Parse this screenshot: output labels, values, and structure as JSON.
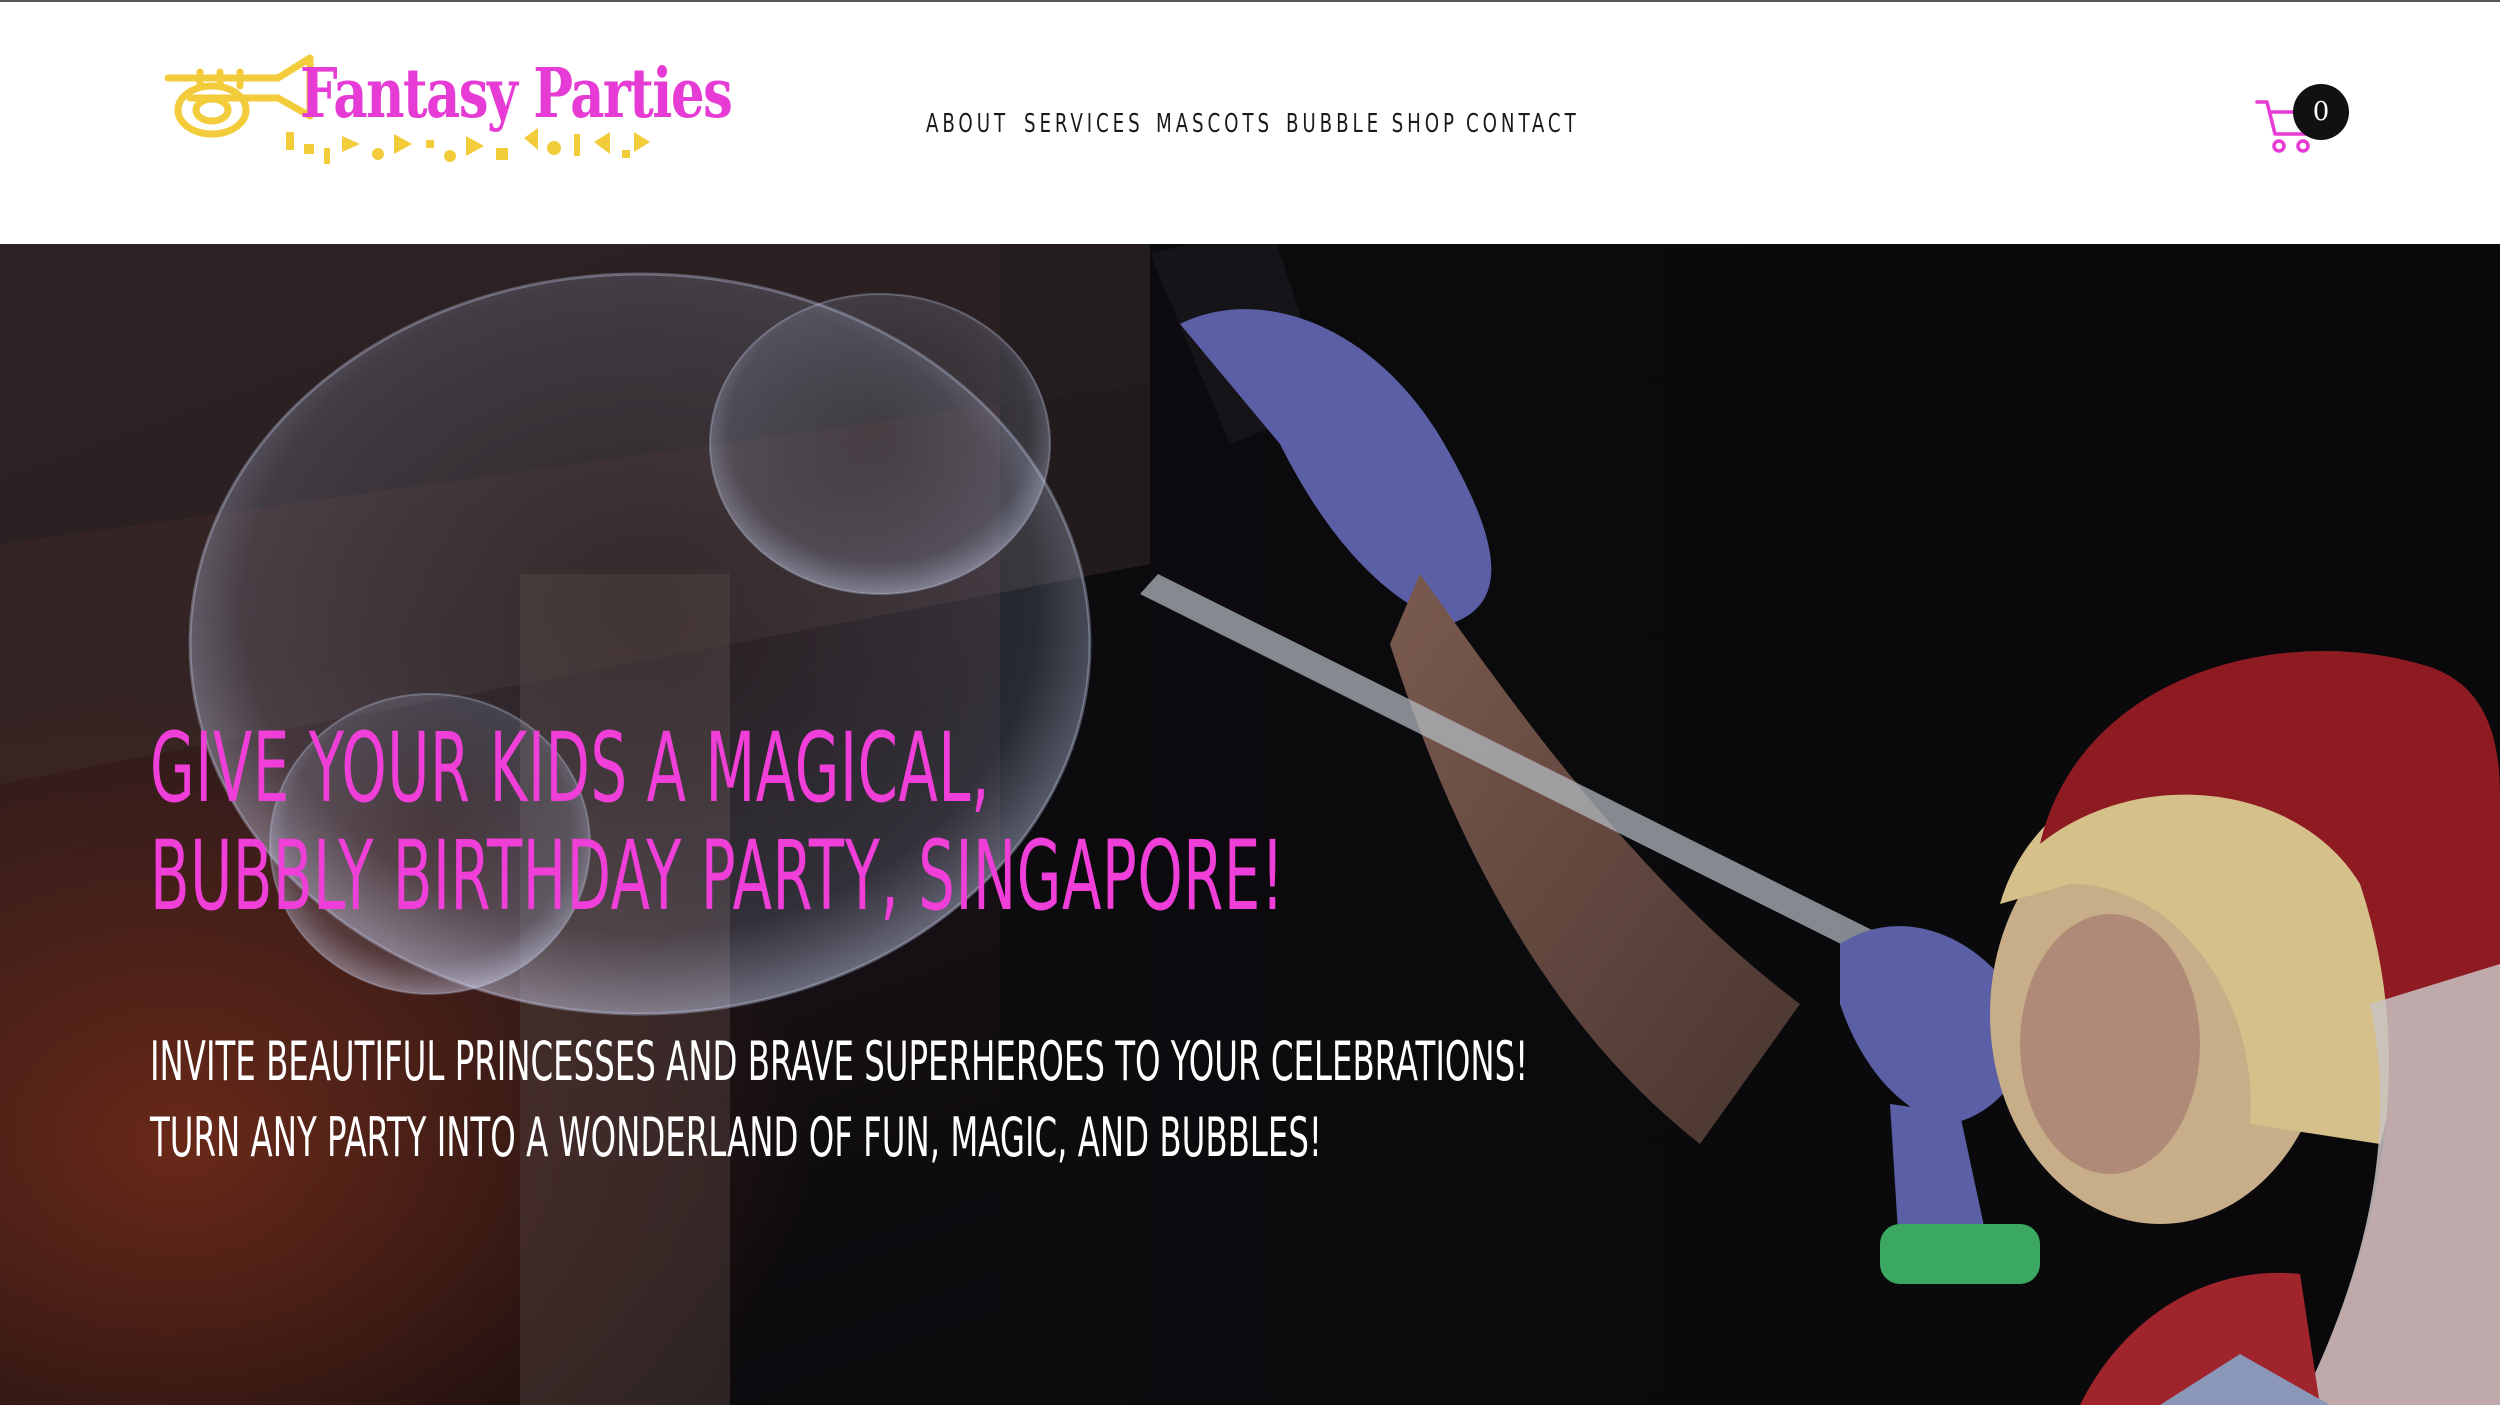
{
  "brand": {
    "name": "Fantasy Parties",
    "primary_color": "#e63bd5",
    "accent_color": "#f2cc3a"
  },
  "nav": {
    "items": [
      {
        "label": "About"
      },
      {
        "label": "Services"
      },
      {
        "label": "Mascots"
      },
      {
        "label": "Bubble Shop"
      },
      {
        "label": "Contact"
      }
    ]
  },
  "cart": {
    "icon": "shopping-cart-icon",
    "count": "0"
  },
  "hero": {
    "heading_line1": "Give your kids a magical,",
    "heading_line2": "bubbly birthday party, Singapore!",
    "sub_line1": "Invite beautiful princesses and brave superheroes to your celebrations!",
    "sub_line2": "Turn any party into a wonderland of fun, magic, and bubbles!",
    "heading_color": "#ef3fd8"
  }
}
